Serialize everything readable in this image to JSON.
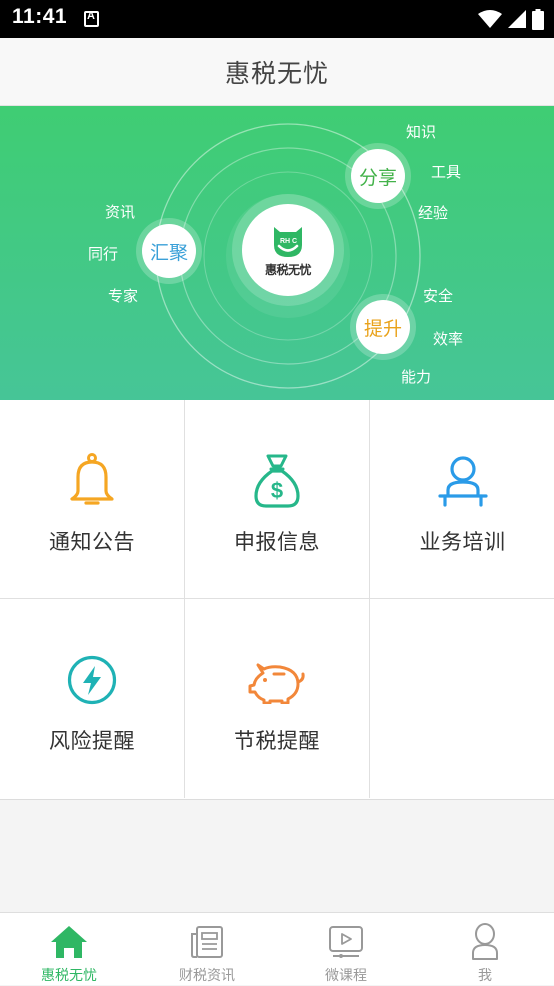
{
  "status_bar": {
    "time": "11:41"
  },
  "header": {
    "title": "惠税无忧"
  },
  "banner": {
    "center_label": "惠税无忧",
    "logo_mark": "RH C",
    "bubbles": {
      "gather": "汇聚",
      "share": "分享",
      "improve": "提升"
    },
    "gather_tags": [
      "资讯",
      "同行",
      "专家"
    ],
    "share_tags": [
      "知识",
      "工具",
      "经验"
    ],
    "improve_tags": [
      "安全",
      "效率",
      "能力"
    ]
  },
  "grid": {
    "items": [
      {
        "label": "通知公告",
        "icon": "bell-icon"
      },
      {
        "label": "申报信息",
        "icon": "money-bag-icon"
      },
      {
        "label": "业务培训",
        "icon": "trainer-icon"
      },
      {
        "label": "风险提醒",
        "icon": "lightning-icon"
      },
      {
        "label": "节税提醒",
        "icon": "piggy-bank-icon"
      }
    ]
  },
  "tabbar": {
    "tabs": [
      {
        "label": "惠税无忧",
        "icon": "home-icon",
        "active": true
      },
      {
        "label": "财税资讯",
        "icon": "news-icon",
        "active": false
      },
      {
        "label": "微课程",
        "icon": "video-icon",
        "active": false
      },
      {
        "label": "我",
        "icon": "user-icon",
        "active": false
      }
    ]
  },
  "colors": {
    "brand_green": "#2fb764",
    "bell_orange": "#f5a623",
    "bag_green": "#26b78a",
    "trainer_blue": "#2a9be8",
    "lightning_teal": "#1fb2b5",
    "pig_orange": "#f2873a",
    "gather_blue": "#3aa0d8",
    "share_green": "#43b24a",
    "improve_gold": "#e9a21a"
  }
}
